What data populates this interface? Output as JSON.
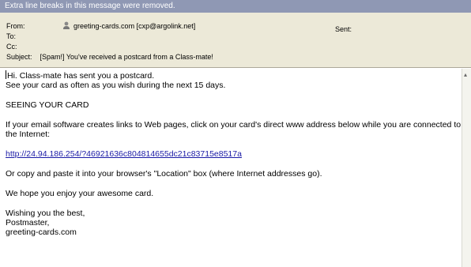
{
  "infobar": {
    "text": "Extra line breaks in this message were removed."
  },
  "header": {
    "from_label": "From:",
    "from_value": "greeting-cards.com [cxp@argolink.net]",
    "to_label": "To:",
    "cc_label": "Cc:",
    "subject_label": "Subject:",
    "subject_value": "[Spam!] You've received a postcard from a Class-mate!",
    "sent_label": "Sent:",
    "from_icon": "contact-icon"
  },
  "body": {
    "line1": "Hi. Class-mate has sent you a postcard.",
    "line2": "See your card as often as you wish during the next 15 days.",
    "section_title": "SEEING YOUR CARD",
    "instructions": "If your email software creates links to Web pages, click on your card's direct www address below while you are connected to the Internet:",
    "link": "http://24.94.186.254/?46921636c804814655dc21c83715e8517a",
    "copy_text": "Or copy and paste it into your browser's \"Location\" box (where Internet addresses go).",
    "enjoy_text": "We hope you enjoy your awesome card.",
    "closing1": "Wishing you the best,",
    "closing2": "Postmaster,",
    "closing3": "greeting-cards.com"
  },
  "colors": {
    "infobar_bg": "#8f98b4",
    "header_bg": "#ece9d8",
    "link": "#1a1aa6"
  }
}
